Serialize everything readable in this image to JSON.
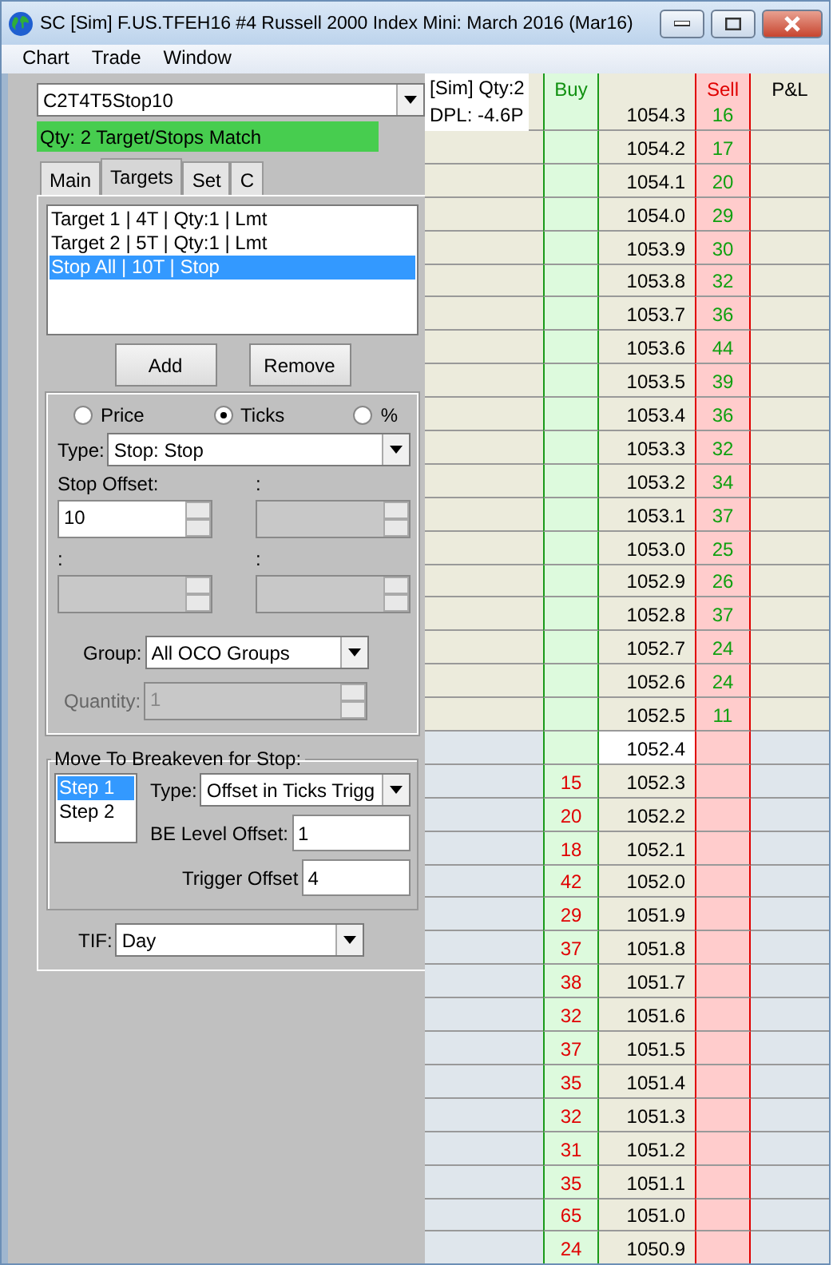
{
  "window": {
    "title": "SC [Sim] F.US.TFEH16  #4  Russell 2000 Index Mini: March 2016 (Mar16)"
  },
  "menu": [
    "Chart",
    "Trade",
    "Window"
  ],
  "left": {
    "preset": "C2T4T5Stop10",
    "status": "Qty: 2 Target/Stops Match",
    "tabs": [
      {
        "label": "Main",
        "selected": false
      },
      {
        "label": "Targets",
        "selected": true
      },
      {
        "label": "Set",
        "selected": false
      },
      {
        "label": "C",
        "selected": false
      }
    ],
    "targets": [
      {
        "label": "Target 1 | 4T | Qty:1 | Lmt",
        "selected": false
      },
      {
        "label": "Target 2 | 5T | Qty:1 | Lmt",
        "selected": false
      },
      {
        "label": "Stop All | 10T | Stop",
        "selected": true
      }
    ],
    "buttons": [
      "Add",
      "Remove"
    ],
    "offset_modes": [
      {
        "label": "Price",
        "selected": false
      },
      {
        "label": "Ticks",
        "selected": true
      },
      {
        "label": "%",
        "selected": false
      }
    ],
    "type": {
      "label": "Type:",
      "value": "Stop: Stop"
    },
    "offsets": [
      {
        "label": "Stop Offset:",
        "value": "10",
        "disabled": false
      },
      {
        "label": ":",
        "disabled": true
      },
      {
        "label": ":",
        "disabled": true
      },
      {
        "label": ":",
        "disabled": true
      }
    ],
    "group": {
      "label": "Group:",
      "value": "All OCO Groups"
    },
    "quantity": {
      "label": "Quantity:",
      "value": "1",
      "disabled": true
    },
    "breakeven": {
      "title": "Move To Breakeven for Stop:",
      "steps": [
        {
          "label": "Step 1",
          "selected": true
        },
        {
          "label": "Step 2",
          "selected": false
        }
      ],
      "type": {
        "label": "Type:",
        "value": "Offset in Ticks Trigg"
      },
      "level_offset": {
        "label": "BE Level Offset:",
        "value": "1"
      },
      "trigger_offset": {
        "label": "Trigger Offset",
        "value": "4"
      }
    },
    "tif": {
      "label": "TIF:",
      "value": "Day"
    }
  },
  "dom": {
    "info": [
      "[Sim]  Qty:2",
      "DPL: -4.6P"
    ],
    "columns": [
      "Buy",
      "Sell",
      "P&L"
    ],
    "rows": [
      {
        "kind": "ask",
        "price": "1054.3",
        "sell": "16"
      },
      {
        "kind": "ask",
        "price": "1054.2",
        "sell": "17"
      },
      {
        "kind": "ask",
        "price": "1054.1",
        "sell": "20"
      },
      {
        "kind": "ask",
        "price": "1054.0",
        "sell": "29"
      },
      {
        "kind": "ask",
        "price": "1053.9",
        "sell": "30"
      },
      {
        "kind": "ask",
        "price": "1053.8",
        "sell": "32"
      },
      {
        "kind": "ask",
        "price": "1053.7",
        "sell": "36"
      },
      {
        "kind": "ask",
        "price": "1053.6",
        "sell": "44"
      },
      {
        "kind": "ask",
        "price": "1053.5",
        "sell": "39"
      },
      {
        "kind": "ask",
        "price": "1053.4",
        "sell": "36"
      },
      {
        "kind": "ask",
        "price": "1053.3",
        "sell": "32"
      },
      {
        "kind": "ask",
        "price": "1053.2",
        "sell": "34"
      },
      {
        "kind": "ask",
        "price": "1053.1",
        "sell": "37"
      },
      {
        "kind": "ask",
        "price": "1053.0",
        "sell": "25"
      },
      {
        "kind": "ask",
        "price": "1052.9",
        "sell": "26"
      },
      {
        "kind": "ask",
        "price": "1052.8",
        "sell": "37"
      },
      {
        "kind": "ask",
        "price": "1052.7",
        "sell": "24"
      },
      {
        "kind": "ask",
        "price": "1052.6",
        "sell": "24"
      },
      {
        "kind": "ask",
        "price": "1052.5",
        "sell": "11"
      },
      {
        "kind": "gap",
        "price": "1052.4"
      },
      {
        "kind": "bid",
        "price": "1052.3",
        "buy": "15"
      },
      {
        "kind": "bid",
        "price": "1052.2",
        "buy": "20"
      },
      {
        "kind": "bid",
        "price": "1052.1",
        "buy": "18"
      },
      {
        "kind": "bid",
        "price": "1052.0",
        "buy": "42"
      },
      {
        "kind": "bid",
        "price": "1051.9",
        "buy": "29"
      },
      {
        "kind": "bid",
        "price": "1051.8",
        "buy": "37"
      },
      {
        "kind": "bid",
        "price": "1051.7",
        "buy": "38"
      },
      {
        "kind": "bid",
        "price": "1051.6",
        "buy": "32"
      },
      {
        "kind": "bid",
        "price": "1051.5",
        "buy": "37"
      },
      {
        "kind": "bid",
        "price": "1051.4",
        "buy": "35"
      },
      {
        "kind": "bid",
        "price": "1051.3",
        "buy": "32"
      },
      {
        "kind": "bid",
        "price": "1051.2",
        "buy": "31"
      },
      {
        "kind": "bid",
        "price": "1051.1",
        "buy": "35"
      },
      {
        "kind": "bid",
        "price": "1051.0",
        "buy": "65"
      },
      {
        "kind": "bid",
        "price": "1050.9",
        "buy": "24"
      }
    ]
  }
}
